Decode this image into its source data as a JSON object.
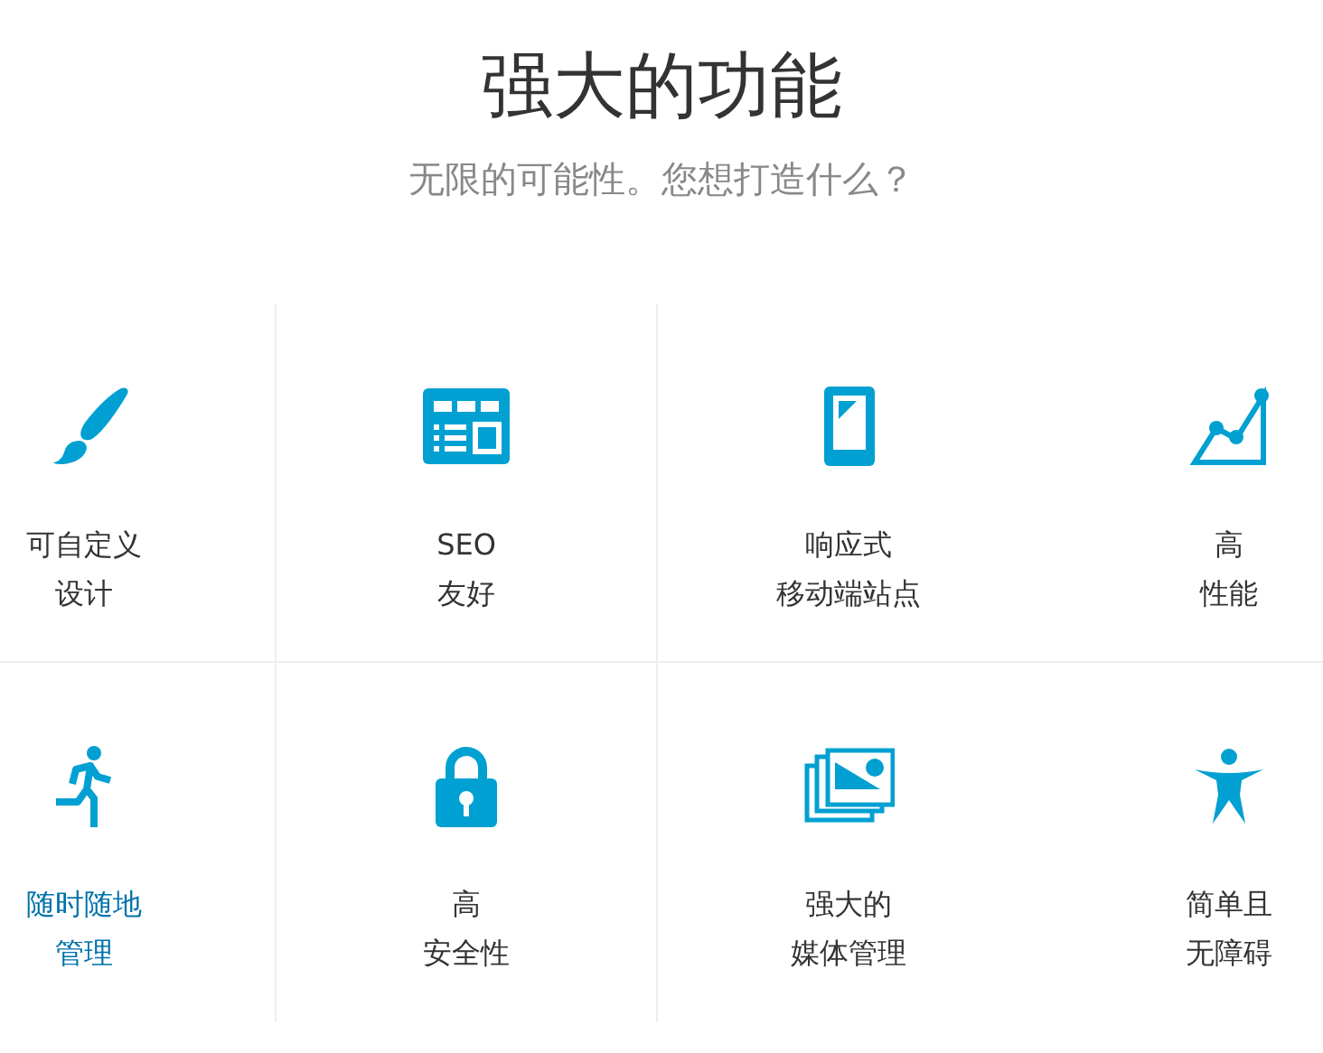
{
  "heading": {
    "title": "强大的功能",
    "subtitle": "无限的可能性。您想打造什么？"
  },
  "features": [
    {
      "kind": "brush",
      "lines": [
        "可自定义",
        "设计"
      ],
      "highlighted": false
    },
    {
      "kind": "layout",
      "lines": [
        "SEO",
        "友好"
      ],
      "highlighted": false
    },
    {
      "kind": "phone",
      "lines": [
        "响应式",
        "移动端站点"
      ],
      "highlighted": false
    },
    {
      "kind": "chart",
      "lines": [
        "高",
        "性能"
      ],
      "highlighted": false
    },
    {
      "kind": "runner",
      "lines": [
        "随时随地",
        "管理"
      ],
      "highlighted": true
    },
    {
      "kind": "lock",
      "lines": [
        "高",
        "安全性"
      ],
      "highlighted": false
    },
    {
      "kind": "images",
      "lines": [
        "强大的",
        "媒体管理"
      ],
      "highlighted": false
    },
    {
      "kind": "person",
      "lines": [
        "简单且",
        "无障碍"
      ],
      "highlighted": false
    }
  ]
}
